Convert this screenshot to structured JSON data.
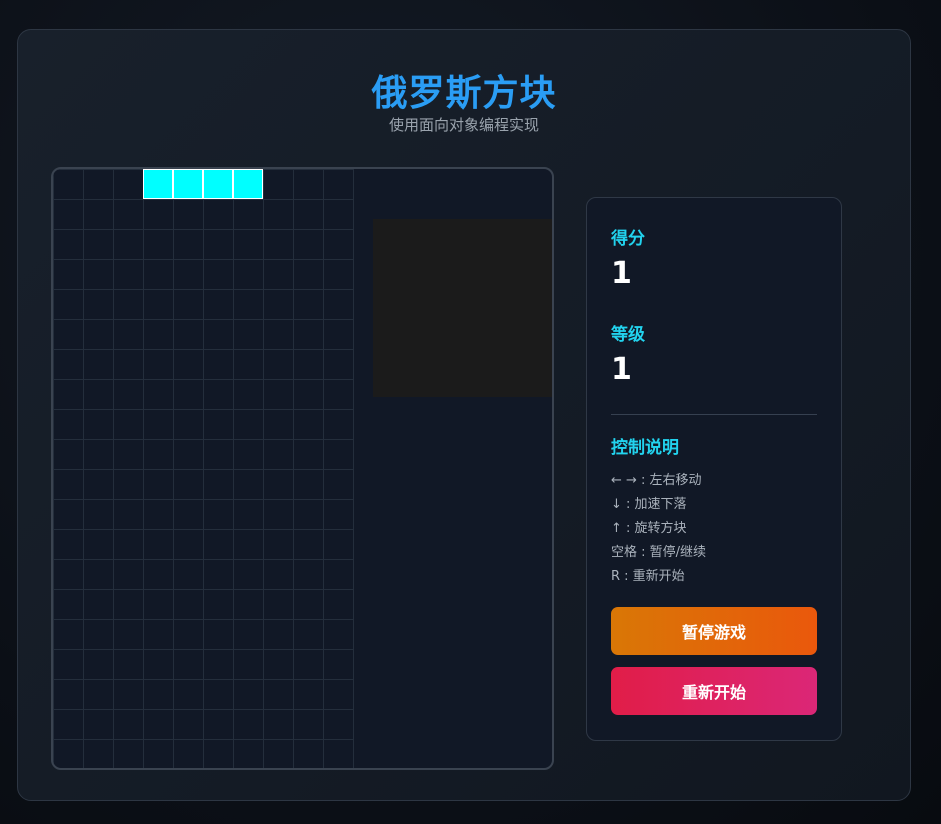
{
  "header": {
    "title": "俄罗斯方块",
    "subtitle": "使用面向对象编程实现"
  },
  "board": {
    "columns": 10,
    "rows": 20,
    "active_piece": {
      "color": "#00ffff",
      "cells": [
        [
          0,
          3
        ],
        [
          0,
          4
        ],
        [
          0,
          5
        ],
        [
          0,
          6
        ]
      ]
    }
  },
  "stats": {
    "score_label": "得分",
    "score_value": "1",
    "level_label": "等级",
    "level_value": "1"
  },
  "controls": {
    "title": "控制说明",
    "lines": [
      "← → : 左右移动",
      "↓ : 加速下落",
      "↑ : 旋转方块",
      "空格 : 暂停/继续",
      "R : 重新开始"
    ]
  },
  "buttons": {
    "pause_label": "暂停游戏",
    "restart_label": "重新开始"
  },
  "colors": {
    "title": "#2a9df4",
    "accent": "#22d3ee",
    "pause_button": "#ea580c",
    "restart_button": "#e11d48"
  }
}
